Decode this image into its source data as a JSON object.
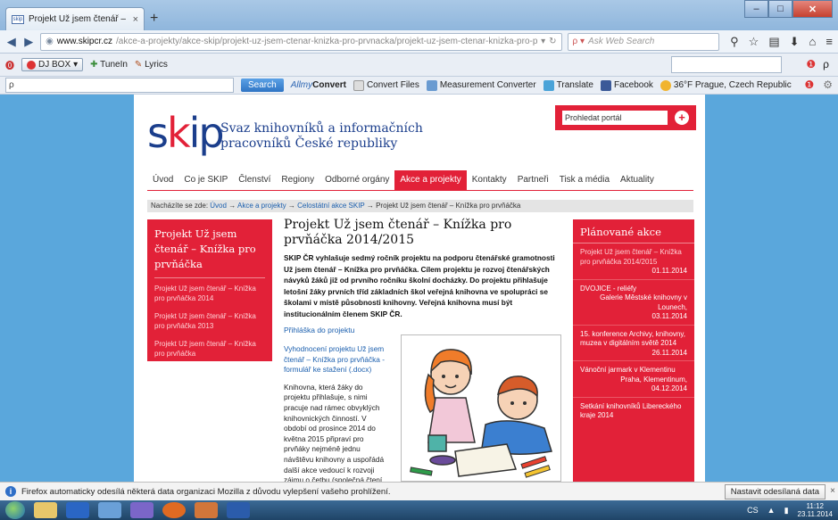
{
  "browser": {
    "tab_title": "Projekt Už jsem čtenář – Kn...",
    "tab_favicon_text": "skip",
    "new_tab_symbol": "+",
    "url_host": "www.skipcr.cz",
    "url_path": "/akce-a-projekty/akce-skip/projekt-uz-jsem-ctenar-knizka-pro-prvnacka/projekt-uz-jsem-ctenar-knizka-pro-prvnacka-2014-2015",
    "search_placeholder": "Ask Web Search",
    "window_controls": {
      "min": "–",
      "max": "□",
      "close": "✕"
    }
  },
  "bookmarks": {
    "djbox": "DJ BOX",
    "tuneln": "TuneIn",
    "lyrics": "Lyrics"
  },
  "toolbar2": {
    "search_icon": "ρ",
    "search_button": "Search",
    "allmy": "Allmy",
    "convert": "Convert",
    "items": [
      "Convert Files",
      "Measurement Converter",
      "Translate",
      "Facebook",
      "36°F Prague, Czech Republic"
    ]
  },
  "site": {
    "logo_s": "s",
    "logo_k": "k",
    "logo_ip": "ip",
    "tagline_1": "Svaz knihovníků a informačních",
    "tagline_2": "pracovníků České republiky",
    "portal_placeholder": "Prohledat portál",
    "portal_go": "+",
    "menu": [
      "Úvod",
      "Co je SKIP",
      "Členství",
      "Regiony",
      "Odborné orgány",
      "Akce a projekty",
      "Kontakty",
      "Partneři",
      "Tisk a média",
      "Aktuality"
    ],
    "active_menu": "Akce a projekty",
    "crumbs_prefix": "Nacházíte se zde:",
    "crumbs": [
      "Úvod",
      "Akce a projekty",
      "Celostátní akce SKIP",
      "Projekt Už jsem čtenář – Knížka pro prvňáčka"
    ],
    "crumb_sep": "→"
  },
  "leftbox": {
    "title": "Projekt Už jsem čtenář – Knížka pro prvňáčka",
    "links": [
      "Projekt Už jsem čtenář – Knížka pro prvňáčka 2014",
      "Projekt Už jsem čtenář – Knížka pro prvňáčka 2013",
      "Projekt Už jsem čtenář – Knížka pro prvňáčka"
    ]
  },
  "main": {
    "title": "Projekt Už jsem čtenář – Knížka pro prvňáčka 2014/2015",
    "intro": "SKIP ČR vyhlašuje sedmý ročník projektu na podporu čtenářské gramotnosti Už jsem čtenář – Knížka pro prvňáčka. Cílem projektu je rozvoj čtenářských návyků žáků již od prvního ročníku školní docházky. Do projektu přihlašuje letošní žáky prvních tříd základních škol veřejná knihovna ve spolupráci se školami v místě působnosti knihovny. Veřejná knihovna musí být institucionálním členem SKIP ČR.",
    "link_application": "Přihláška do projektu",
    "link_evaluation": "Vyhodnocení projektu Už jsem čtenář – Knížka pro prvňáčka - formulář ke stažení (.docx)",
    "paragraph": "Knihovna, která žáky do projektu přihlašuje, s nimi pracuje nad rámec obvyklých knihovnických činností. V období od prosince 2014 do května 2015 připraví pro prvňáky nejméně jednu návštěvu knihovny a uspořádá další akce vedoucí k rozvoji zájmu o četbu (společná čtení, besedy s tvůrci knih, výstavy apod.)."
  },
  "rightbox": {
    "title": "Plánované akce",
    "events": [
      {
        "title": "Projekt Už jsem čtenář – Knížka pro prvňáčka 2014/2015",
        "place": "",
        "date": "01.11.2014",
        "highlight": true
      },
      {
        "title": "DVOJICE - reliéfy",
        "place": "Galerie Městské knihovny v Lounech,",
        "date": "03.11.2014",
        "highlight": false
      },
      {
        "title": "15. konference Archivy, knihovny, muzea v digitálním světě 2014",
        "place": "",
        "date": "26.11.2014",
        "highlight": false
      },
      {
        "title": "Vánoční jarmark v Klementinu",
        "place": "Praha, Klementinum,",
        "date": "04.12.2014",
        "highlight": false
      },
      {
        "title": "Setkání knihovníků Libereckého kraje 2014",
        "place": "",
        "date": "",
        "highlight": false
      }
    ]
  },
  "notification": {
    "text": "Firefox automaticky odesílá některá data organizaci Mozilla z důvodu vylepšení vašeho prohlížení.",
    "button": "Nastavit odesílaná data",
    "close": "×"
  },
  "taskbar": {
    "lang": "CS",
    "time": "11:12",
    "date": "23.11.2014"
  }
}
